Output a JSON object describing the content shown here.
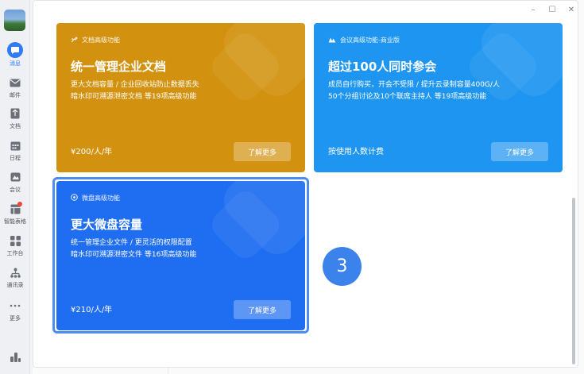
{
  "sidebar": {
    "items": [
      {
        "label": "消息",
        "icon": "chat-bubble-icon",
        "active": true
      },
      {
        "label": "邮件",
        "icon": "mail-icon"
      },
      {
        "label": "文档",
        "icon": "document-icon"
      },
      {
        "label": "日程",
        "icon": "calendar-icon"
      },
      {
        "label": "会议",
        "icon": "meeting-icon"
      },
      {
        "label": "智能表格",
        "icon": "smart-table-icon"
      },
      {
        "label": "工作台",
        "icon": "workbench-icon"
      },
      {
        "label": "通讯录",
        "icon": "contacts-icon"
      },
      {
        "label": "更多",
        "icon": "more-dots-icon"
      }
    ],
    "bottom_icon": "stats-icon"
  },
  "window_controls": {
    "minimize": "–",
    "maximize": "☐",
    "close": "✕"
  },
  "cards": {
    "docs": {
      "tag": "文档高级功能",
      "title": "统一管理企业文档",
      "desc_line1": "更大文档容量 / 企业回收站防止数据丢失",
      "desc_line2": "暗水印可溯源泄密文档 等19项高级功能",
      "price": "¥200/人/年",
      "button": "了解更多",
      "color": "#d2920f"
    },
    "meeting": {
      "tag": "会议高级功能-商业版",
      "title": "超过100人同时参会",
      "desc_line1": "成员自行购买，开会不受限 / 提升云录制容量400G/人",
      "desc_line2": "50个分组讨论及10个联席主持人 等19项高级功能",
      "price": "按使用人数计费",
      "button": "了解更多",
      "color": "#1e95f0"
    },
    "disk": {
      "tag": "微盘高级功能",
      "title": "更大微盘容量",
      "desc_line1": "统一管理企业文件 / 更灵活的权限配置",
      "desc_line2": "暗水印可溯源泄密文件 等16项高级功能",
      "price": "¥210/人/年",
      "button": "了解更多",
      "color": "#1f6ef2"
    }
  },
  "step_marker": "3"
}
